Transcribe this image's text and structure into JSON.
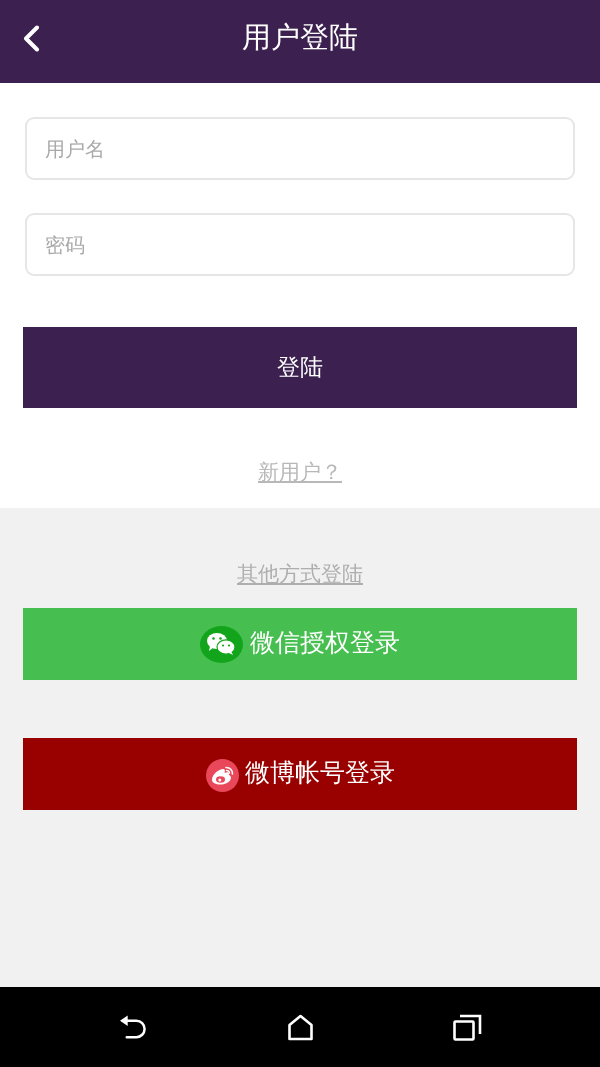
{
  "header": {
    "title": "用户登陆"
  },
  "form": {
    "username": {
      "placeholder": "用户名"
    },
    "password": {
      "placeholder": "密码"
    },
    "submit": "登陆",
    "register_link": "新用户？"
  },
  "other_login": {
    "heading": "其他方式登陆",
    "buttons": [
      {
        "kind": "wechat",
        "label": "微信授权登录"
      },
      {
        "kind": "weibo",
        "label": "微博帐号登录"
      }
    ]
  }
}
